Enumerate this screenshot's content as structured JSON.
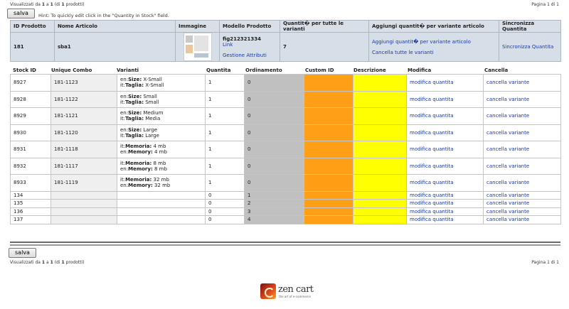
{
  "pager": {
    "summary_prefix": "Visualizzati da",
    "from": "1",
    "mid": "a",
    "to": "1",
    "of_prefix": "(di",
    "total": "1",
    "of_suffix": "prodotti)",
    "page_label": "Pagina 1 di 1"
  },
  "toolbar": {
    "save_label": "salva",
    "hint": "Hint: To quickly edit click in the \"Quantity in Stock\" field."
  },
  "product_table": {
    "headers": [
      "ID Prodotto",
      "Nome Articolo",
      "Immagine",
      "Modello Prodotto",
      "Quantit� per tutte le varianti",
      "Aggiungi quantit� per variante articolo",
      "Sincronizza Quantita"
    ],
    "row": {
      "id": "181",
      "name": "sba1",
      "image_icon": "product-thumbnail",
      "model": "fig212321334",
      "link_label": "Link",
      "attributes_label": "Gestione Attributi",
      "qty": "7",
      "add_qty_label": "Aggiungi quantit� per variante articolo",
      "delete_all_label": "Cancella tutte le varianti",
      "sync_label": "Sincronizza Quantita"
    }
  },
  "stock_table": {
    "headers": [
      "Stock ID",
      "Unique Combo",
      "Varianti",
      "Quantita",
      "Ordinamento",
      "Custom ID",
      "Descrizione",
      "Modifica",
      "Cancella"
    ],
    "rows": [
      {
        "id": "8927",
        "combo": "181-1123",
        "v1k": "en:",
        "v1n": "Size:",
        "v1v": " X-Small",
        "v2k": "it:",
        "v2n": "Taglia:",
        "v2v": " X-Small",
        "qty": "1",
        "ord": "0",
        "edit": "modifica quantita",
        "del": "cancella variante"
      },
      {
        "id": "8928",
        "combo": "181-1122",
        "v1k": "en:",
        "v1n": "Size:",
        "v1v": " Small",
        "v2k": "it:",
        "v2n": "Taglia:",
        "v2v": " Small",
        "qty": "1",
        "ord": "0",
        "edit": "modifica quantita",
        "del": "cancella variante"
      },
      {
        "id": "8929",
        "combo": "181-1121",
        "v1k": "en:",
        "v1n": "Size:",
        "v1v": " Medium",
        "v2k": "it:",
        "v2n": "Taglia:",
        "v2v": " Media",
        "qty": "1",
        "ord": "0",
        "edit": "modifica quantita",
        "del": "cancella variante"
      },
      {
        "id": "8930",
        "combo": "181-1120",
        "v1k": "en:",
        "v1n": "Size:",
        "v1v": " Large",
        "v2k": "it:",
        "v2n": "Taglia:",
        "v2v": " Large",
        "qty": "1",
        "ord": "0",
        "edit": "modifica quantita",
        "del": "cancella variante"
      },
      {
        "id": "8931",
        "combo": "181-1118",
        "v1k": "it:",
        "v1n": "Memoria:",
        "v1v": " 4 mb",
        "v2k": "en:",
        "v2n": "Memory:",
        "v2v": " 4 mb",
        "qty": "1",
        "ord": "0",
        "edit": "modifica quantita",
        "del": "cancella variante"
      },
      {
        "id": "8932",
        "combo": "181-1117",
        "v1k": "it:",
        "v1n": "Memoria:",
        "v1v": " 8 mb",
        "v2k": "en:",
        "v2n": "Memory:",
        "v2v": " 8 mb",
        "qty": "1",
        "ord": "0",
        "edit": "modifica quantita",
        "del": "cancella variante"
      },
      {
        "id": "8933",
        "combo": "181-1119",
        "v1k": "it:",
        "v1n": "Memoria:",
        "v1v": " 32 mb",
        "v2k": "en:",
        "v2n": "Memory:",
        "v2v": " 32 mb",
        "qty": "1",
        "ord": "0",
        "edit": "modifica quantita",
        "del": "cancella variante"
      },
      {
        "id": "134",
        "combo": "",
        "qty": "0",
        "ord": "1",
        "edit": "modifica quantita",
        "del": "cancella variante"
      },
      {
        "id": "135",
        "combo": "",
        "qty": "0",
        "ord": "2",
        "edit": "modifica quantita",
        "del": "cancella variante"
      },
      {
        "id": "136",
        "combo": "",
        "qty": "0",
        "ord": "3",
        "edit": "modifica quantita",
        "del": "cancella variante"
      },
      {
        "id": "137",
        "combo": "",
        "qty": "0",
        "ord": "4",
        "edit": "modifica quantita",
        "del": "cancella variante"
      }
    ]
  },
  "footer": {
    "logo_icon": "zen-cart-logo",
    "logo_text": "zen cart",
    "logo_tagline": "the art of e-commerce"
  }
}
